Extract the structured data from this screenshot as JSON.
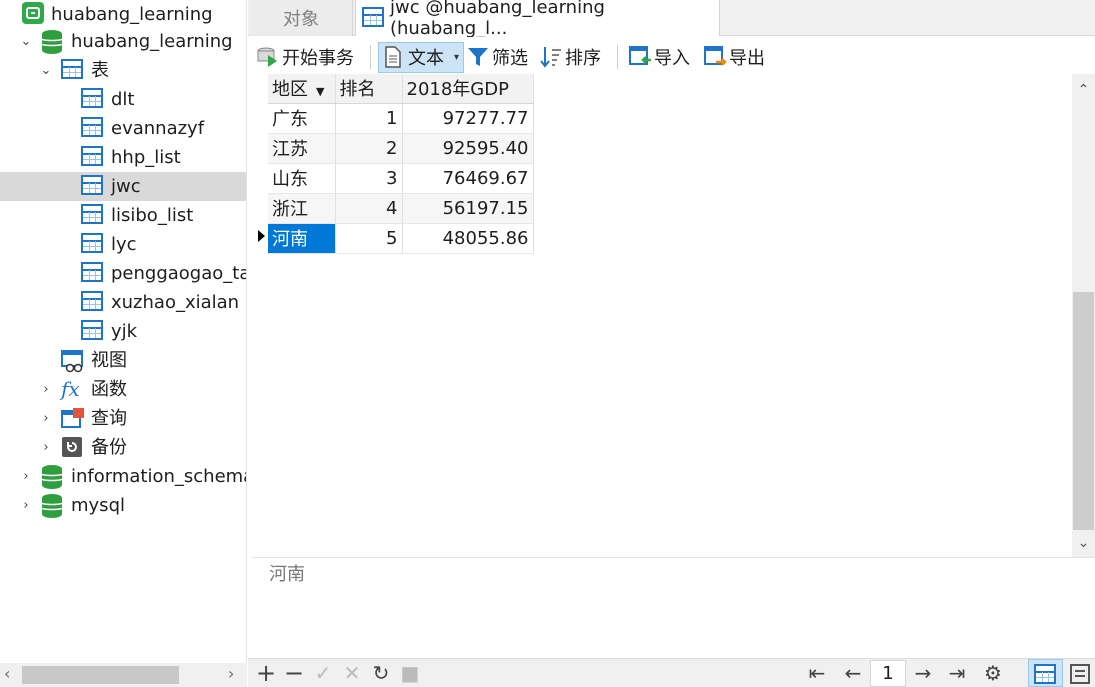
{
  "sidebar": {
    "connection": "huabang_learning",
    "database": "huabang_learning",
    "tables_label": "表",
    "tables": [
      "dlt",
      "evannazyf",
      "hhp_list",
      "jwc",
      "lisibo_list",
      "lyc",
      "penggaogao_ta",
      "xuzhao_xialan",
      "yjk"
    ],
    "selected_table": "jwc",
    "views_label": "视图",
    "functions_label": "函数",
    "queries_label": "查询",
    "backups_label": "备份",
    "other_databases": [
      "information_schema",
      "mysql"
    ]
  },
  "tabs": {
    "objects": "对象",
    "active": "jwc @huabang_learning (huabang_l..."
  },
  "toolbar": {
    "begin_transaction": "开始事务",
    "text": "文本",
    "filter": "筛选",
    "sort": "排序",
    "import": "导入",
    "export": "导出"
  },
  "grid": {
    "columns": [
      "地区",
      "排名",
      "2018年GDP"
    ],
    "rows": [
      {
        "region": "广东",
        "rank": "1",
        "gdp": "97277.77"
      },
      {
        "region": "江苏",
        "rank": "2",
        "gdp": "92595.40"
      },
      {
        "region": "山东",
        "rank": "3",
        "gdp": "76469.67"
      },
      {
        "region": "浙江",
        "rank": "4",
        "gdp": "56197.15"
      },
      {
        "region": "河南",
        "rank": "5",
        "gdp": "48055.86"
      }
    ],
    "selected_row": 4
  },
  "detail": {
    "value": "河南"
  },
  "pager": {
    "page": "1"
  },
  "colors": {
    "accent": "#0078d7",
    "db_icon": "#2e9e3f",
    "table_icon": "#1e74c9"
  }
}
